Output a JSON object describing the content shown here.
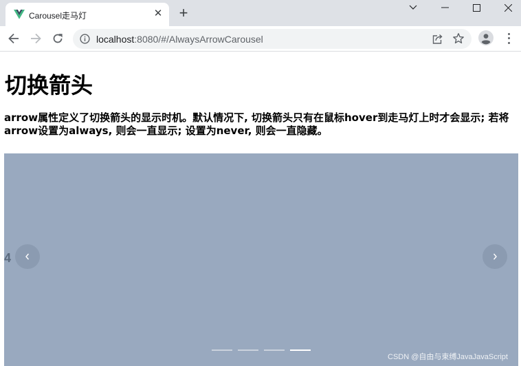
{
  "browser": {
    "tab_title": "Carousel走马灯",
    "url_host": "localhost",
    "url_rest": ":8080/#/AlwaysArrowCarousel"
  },
  "page": {
    "title": "切换箭头",
    "description": "arrow属性定义了切换箭头的显示时机。默认情况下, 切换箭头只有在鼠标hover到走马灯上时才会显示; 若将arrow设置为always, 则会一直显示; 设置为never, 则会一直隐藏。"
  },
  "carousel": {
    "slide_label": "4",
    "background_color": "#99a9bf",
    "indicator_count": 4,
    "active_index": 3
  },
  "watermark": "CSDN @自由与束缚JavaJavaScript",
  "icons": {
    "favicon": "vue-logo-icon",
    "close": "close-icon",
    "new_tab": "plus-icon",
    "back": "arrow-left-icon",
    "forward": "arrow-right-icon",
    "reload": "reload-icon",
    "info": "info-icon",
    "share": "share-icon",
    "bookmark": "star-icon",
    "profile": "avatar-icon",
    "menu": "more-vertical-icon"
  }
}
